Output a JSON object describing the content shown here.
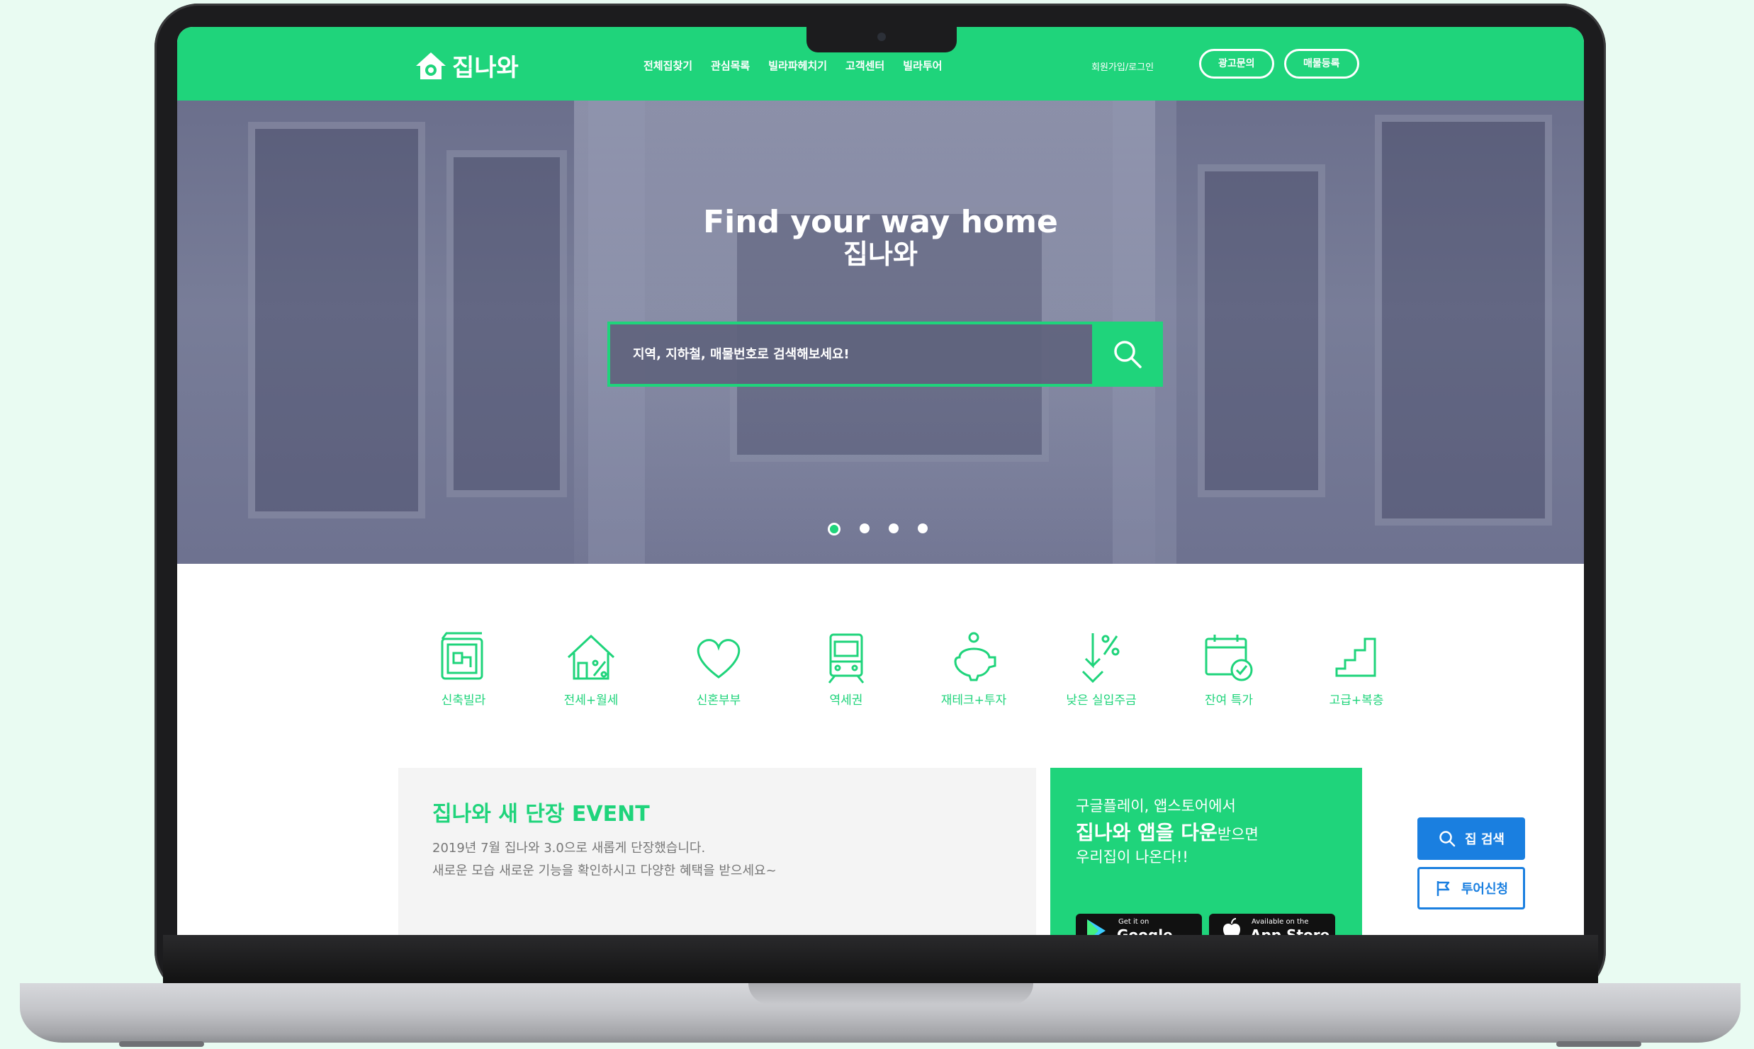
{
  "header": {
    "logo_text": "집나와",
    "nav": [
      "전체집찾기",
      "관심목록",
      "빌라파헤치기",
      "고객센터",
      "빌라투어"
    ],
    "login": "회원가입/로그인",
    "ad_button": "광고문의",
    "register_button": "매물등록",
    "brand_color": "#1fd47b"
  },
  "hero": {
    "title": "Find your way home",
    "subtitle": "집나와",
    "search_placeholder": "지역, 지하철, 매물번호로 검색해보세요!",
    "slides_total": 4,
    "active_slide": 1
  },
  "categories": [
    {
      "label": "신축빌라",
      "icon": "new-villa-icon"
    },
    {
      "label": "전세+월세",
      "icon": "house-percent-icon"
    },
    {
      "label": "신혼부부",
      "icon": "heart-icon"
    },
    {
      "label": "역세권",
      "icon": "train-icon"
    },
    {
      "label": "재테크+투자",
      "icon": "piggy-bank-icon"
    },
    {
      "label": "낮은 실입주금",
      "icon": "down-percent-icon"
    },
    {
      "label": "잔여 특가",
      "icon": "calendar-check-icon"
    },
    {
      "label": "고급+복층",
      "icon": "stairs-icon"
    }
  ],
  "event": {
    "title": "집나와 새 단장 EVENT",
    "line1": "2019년 7월 집나와 3.0으로 새롭게 단장했습니다.",
    "line2": "새로운 모습 새로운 기능을 확인하시고 다양한 혜택을 받으세요~"
  },
  "app_promo": {
    "line1": "구글플레이, 앱스토어에서",
    "line2_bold": "집나와 앱을 다운",
    "line2_rest": "받으면",
    "line3": "우리집이 나온다!!",
    "google_small": "Get it on",
    "google_big": "Google Play",
    "apple_small": "Available on the",
    "apple_big": "App Store"
  },
  "side": {
    "search_home": "집 검색",
    "tour_request": "투어신청",
    "accent": "#1a7fe0"
  }
}
